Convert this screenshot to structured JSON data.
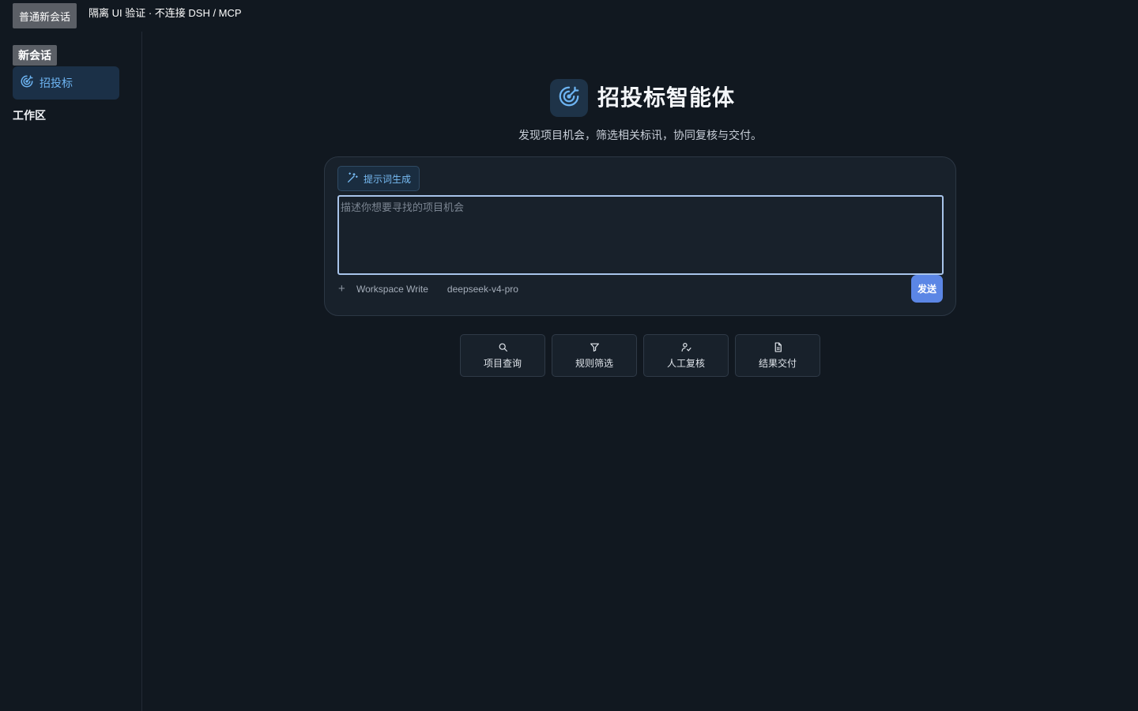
{
  "topbar": {
    "button_label": "普通新会话",
    "note": "隔离 UI 验证 · 不连接 DSH / MCP"
  },
  "sidebar": {
    "new_chat_label": "新会话",
    "active_item": {
      "label": "招投标",
      "icon": "target-icon"
    },
    "workspace_label": "工作区"
  },
  "hero": {
    "icon": "target-icon",
    "title": "招投标智能体",
    "subtitle": "发现项目机会，筛选相关标讯，协同复核与交付。"
  },
  "composer": {
    "prompt_gen_label": "提示词生成",
    "placeholder": "描述你想要寻找的项目机会",
    "value": "",
    "add_icon": "plus-icon",
    "mode_label": "Workspace Write",
    "model_label": "deepseek-v4-pro",
    "send_label": "发送"
  },
  "actions": [
    {
      "label": "项目查询",
      "icon": "search-icon"
    },
    {
      "label": "规则筛选",
      "icon": "filter-icon"
    },
    {
      "label": "人工复核",
      "icon": "user-check-icon"
    },
    {
      "label": "结果交付",
      "icon": "document-icon"
    }
  ],
  "colors": {
    "background": "#111820",
    "accent": "#6db4f2",
    "send_button": "#5b86e5",
    "active_nav_bg": "#1b3047"
  }
}
